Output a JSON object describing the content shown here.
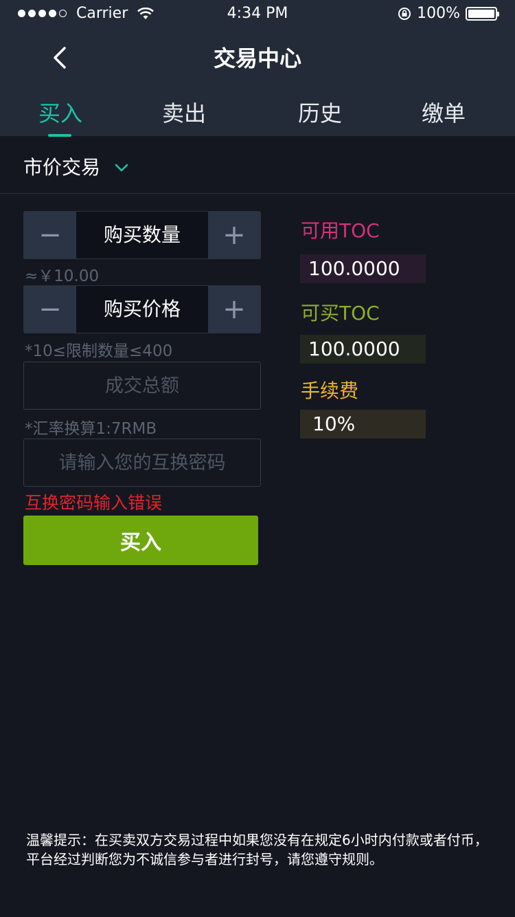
{
  "status_bar": {
    "carrier": "Carrier",
    "time": "4:34 PM",
    "battery": "100%"
  },
  "nav": {
    "title": "交易中心"
  },
  "tabs": [
    {
      "label": "买入",
      "active": true
    },
    {
      "label": "卖出",
      "active": false
    },
    {
      "label": "历史",
      "active": false
    },
    {
      "label": "缴单",
      "active": false
    }
  ],
  "market_select": {
    "value": "市价交易"
  },
  "form": {
    "quantity_label": "购买数量",
    "approx_value": "≈￥10.00",
    "price_label": "购买价格",
    "limit_hint": "*10≤限制数量≤400",
    "total_placeholder": "成交总额",
    "rate_hint": "*汇率换算1:7RMB",
    "password_placeholder": "请输入您的互换密码",
    "error": "互换密码输入错误",
    "submit_label": "买入",
    "minus_symbol": "−",
    "plus_symbol": "+"
  },
  "info": {
    "available_label": "可用TOC",
    "available_value": "100.0000",
    "buyable_label": "可买TOC",
    "buyable_value": "100.0000",
    "fee_label": "手续费",
    "fee_value": "10%"
  },
  "colors": {
    "accent": "#1fc1a8",
    "available": "#d4317c",
    "buyable": "#8fb026",
    "fee": "#f0b429",
    "error": "#e0242b",
    "buy_button": "#6fa80d"
  },
  "footer": {
    "note": "温馨提示：在买卖双方交易过程中如果您没有在规定6小时内付款或者付币，平台经过判断您为不诚信参与者进行封号，请您遵守规则。"
  }
}
